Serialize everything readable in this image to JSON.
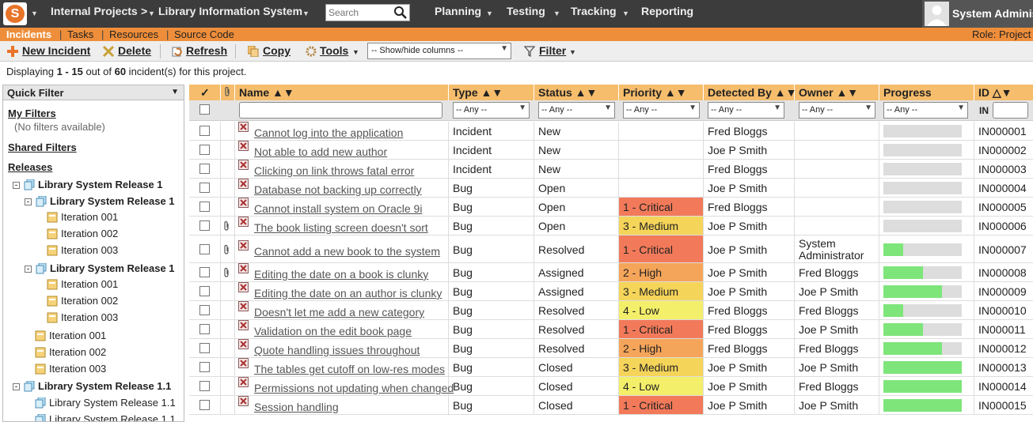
{
  "topbar": {
    "logo_letter": "S",
    "nav": [
      "Internal Projects",
      "Library Information System"
    ],
    "separator": ">",
    "search_placeholder": "Search",
    "menus": [
      "Planning",
      "Testing",
      "Tracking",
      "Reporting"
    ],
    "user": "System Administrator"
  },
  "subnav": {
    "items": [
      "Incidents",
      "Tasks",
      "Resources",
      "Source Code"
    ],
    "role": "Role: Project Owner"
  },
  "toolbar": {
    "new_incident": "New Incident",
    "delete": "Delete",
    "refresh": "Refresh",
    "copy": "Copy",
    "tools": "Tools",
    "showhide": "-- Show/hide columns --",
    "filter": "Filter"
  },
  "displaying": {
    "prefix": "Displaying ",
    "range": "1 - 15",
    "middle": " out of ",
    "total": "60",
    "suffix": " incident(s) for this project."
  },
  "sidebar": {
    "title": "Quick Filter",
    "my_filters": "My Filters",
    "no_filters": "(No filters available)",
    "shared_filters": "Shared Filters",
    "releases": "Releases",
    "tree": [
      {
        "label": "Library System Release 1",
        "level": 0,
        "type": "release",
        "bold": true,
        "toggle": "-"
      },
      {
        "label": "Library System Release 1",
        "level": 1,
        "type": "release",
        "bold": true,
        "toggle": "-"
      },
      {
        "label": "Iteration 001",
        "level": 2,
        "type": "iteration"
      },
      {
        "label": "Iteration 002",
        "level": 2,
        "type": "iteration"
      },
      {
        "label": "Iteration 003",
        "level": 2,
        "type": "iteration"
      },
      {
        "label": "Library System Release 1",
        "level": 1,
        "type": "release",
        "bold": true,
        "toggle": "-"
      },
      {
        "label": "Iteration 001",
        "level": 2,
        "type": "iteration"
      },
      {
        "label": "Iteration 002",
        "level": 2,
        "type": "iteration"
      },
      {
        "label": "Iteration 003",
        "level": 2,
        "type": "iteration"
      },
      {
        "label": "Iteration 001",
        "level": 1.5,
        "type": "iteration"
      },
      {
        "label": "Iteration 002",
        "level": 1.5,
        "type": "iteration"
      },
      {
        "label": "Iteration 003",
        "level": 1.5,
        "type": "iteration"
      },
      {
        "label": "Library System Release 1.1",
        "level": 0,
        "type": "release",
        "bold": true,
        "toggle": "-"
      },
      {
        "label": "Library System Release 1.1",
        "level": 1.5,
        "type": "release"
      },
      {
        "label": "Library System Release 1.1",
        "level": 1.5,
        "type": "release"
      }
    ]
  },
  "grid": {
    "headers": {
      "check": "✓",
      "name": "Name ▲▼",
      "type": "Type ▲▼",
      "status": "Status ▲▼",
      "priority": "Priority ▲▼",
      "detected_by": "Detected By ▲▼",
      "owner": "Owner ▲▼",
      "progress": "Progress",
      "id": "ID △▼"
    },
    "filter_any": "-- Any --",
    "id_filter_label": "IN",
    "priority_colors": {
      "1 - Critical": "#f27a5a",
      "2 - High": "#f5a55a",
      "3 - Medium": "#f5d45a",
      "4 - Low": "#f4ef6a"
    },
    "rows": [
      {
        "attach": false,
        "name": "Cannot log into the application",
        "type": "Incident",
        "status": "New",
        "priority": "",
        "detected": "Fred Bloggs",
        "owner": "",
        "progress": 0,
        "id": "IN000001"
      },
      {
        "attach": false,
        "name": "Not able to add new author",
        "type": "Incident",
        "status": "New",
        "priority": "",
        "detected": "Joe P Smith",
        "owner": "",
        "progress": 0,
        "id": "IN000002"
      },
      {
        "attach": false,
        "name": "Clicking on link throws fatal error",
        "type": "Incident",
        "status": "New",
        "priority": "",
        "detected": "Fred Bloggs",
        "owner": "",
        "progress": 0,
        "id": "IN000003"
      },
      {
        "attach": false,
        "name": "Database not backing up correctly",
        "type": "Bug",
        "status": "Open",
        "priority": "",
        "detected": "Joe P Smith",
        "owner": "",
        "progress": 0,
        "id": "IN000004"
      },
      {
        "attach": false,
        "name": "Cannot install system on Oracle 9i",
        "type": "Bug",
        "status": "Open",
        "priority": "1 - Critical",
        "detected": "Fred Bloggs",
        "owner": "",
        "progress": 0,
        "id": "IN000005"
      },
      {
        "attach": true,
        "name": "The book listing screen doesn't sort",
        "type": "Bug",
        "status": "Open",
        "priority": "3 - Medium",
        "detected": "Joe P Smith",
        "owner": "",
        "progress": 0,
        "id": "IN000006"
      },
      {
        "attach": true,
        "name": "Cannot add a new book to the system",
        "type": "Bug",
        "status": "Resolved",
        "priority": "1 - Critical",
        "detected": "Joe P Smith",
        "owner": "System Administrator",
        "owner_lines": [
          "System",
          "Administrator"
        ],
        "progress": 0.25,
        "id": "IN000007"
      },
      {
        "attach": true,
        "name": "Editing the date on a book is clunky",
        "type": "Bug",
        "status": "Assigned",
        "priority": "2 - High",
        "detected": "Joe P Smith",
        "owner": "Fred Bloggs",
        "progress": 0.5,
        "id": "IN000008"
      },
      {
        "attach": false,
        "name": "Editing the date on an author is clunky",
        "type": "Bug",
        "status": "Assigned",
        "priority": "3 - Medium",
        "detected": "Joe P Smith",
        "owner": "Joe P Smith",
        "progress": 0.75,
        "id": "IN000009"
      },
      {
        "attach": false,
        "name": "Doesn't let me add a new category",
        "type": "Bug",
        "status": "Resolved",
        "priority": "4 - Low",
        "detected": "Fred Bloggs",
        "owner": "Fred Bloggs",
        "progress": 0.25,
        "id": "IN000010"
      },
      {
        "attach": false,
        "name": "Validation on the edit book page",
        "type": "Bug",
        "status": "Resolved",
        "priority": "1 - Critical",
        "detected": "Fred Bloggs",
        "owner": "Joe P Smith",
        "progress": 0.5,
        "id": "IN000011"
      },
      {
        "attach": false,
        "name": "Quote handling issues throughout",
        "type": "Bug",
        "status": "Resolved",
        "priority": "2 - High",
        "detected": "Fred Bloggs",
        "owner": "Fred Bloggs",
        "progress": 0.75,
        "id": "IN000012"
      },
      {
        "attach": false,
        "name": "The tables get cutoff on low-res modes",
        "type": "Bug",
        "status": "Closed",
        "priority": "3 - Medium",
        "detected": "Joe P Smith",
        "owner": "Joe P Smith",
        "progress": 1,
        "id": "IN000013"
      },
      {
        "attach": false,
        "name": "Permissions not updating when changed",
        "type": "Bug",
        "status": "Closed",
        "priority": "4 - Low",
        "detected": "Joe P Smith",
        "owner": "Fred Bloggs",
        "progress": 1,
        "id": "IN000014"
      },
      {
        "attach": false,
        "name": "Session handling",
        "type": "Bug",
        "status": "Closed",
        "priority": "1 - Critical",
        "detected": "Joe P Smith",
        "owner": "Joe P Smith",
        "progress": 1,
        "id": "IN000015"
      }
    ]
  }
}
